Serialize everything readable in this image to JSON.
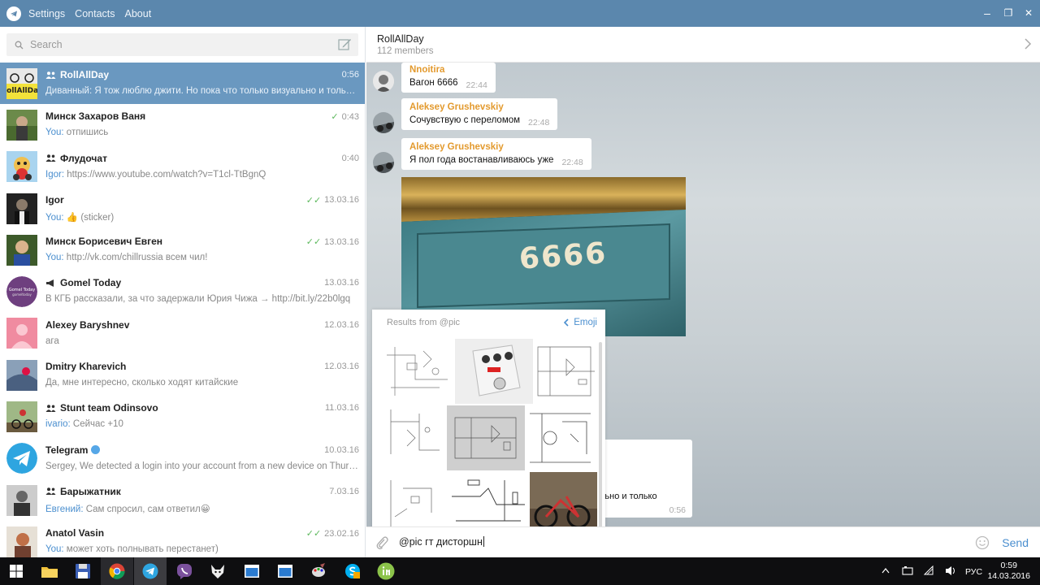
{
  "titlebar": {
    "menu": [
      "Settings",
      "Contacts",
      "About"
    ],
    "controls": {
      "minimize": "–",
      "maximize": "❐",
      "close": "✕"
    }
  },
  "search": {
    "placeholder": "Search"
  },
  "chats": [
    {
      "title": "RollAllDay",
      "group": true,
      "time": "0:56",
      "check": "",
      "sender": "",
      "preview": "Диванный: Я тож люблю джити. Но пока что только визуально и только ..."
    },
    {
      "title": "Минск Захаров Ваня",
      "group": false,
      "time": "0:43",
      "check": "✓",
      "sender": "You:",
      "preview": " отпишись"
    },
    {
      "title": "Флудочат",
      "group": true,
      "time": "0:40",
      "check": "",
      "sender": "Igor:",
      "preview": " https://www.youtube.com/watch?v=T1cl-TtBgnQ"
    },
    {
      "title": "Igor",
      "group": false,
      "time": "13.03.16",
      "check": "✓✓",
      "sender": "You:",
      "preview": " 👍 (sticker)"
    },
    {
      "title": "Минск Борисевич Евген",
      "group": false,
      "time": "13.03.16",
      "check": "✓✓",
      "sender": "You:",
      "preview": " http://vk.com/chillrussia всем чил!"
    },
    {
      "title": "Gomel Today",
      "group": false,
      "channel": true,
      "time": "13.03.16",
      "check": "",
      "sender": "",
      "preview": "В КГБ рассказали, за что задержали Юрия Чижа → http://bit.ly/22b0lgq"
    },
    {
      "title": "Alexey Baryshnev",
      "group": false,
      "time": "12.03.16",
      "check": "",
      "sender": "",
      "preview": "ага"
    },
    {
      "title": "Dmitry Kharevich",
      "group": false,
      "time": "12.03.16",
      "check": "",
      "sender": "",
      "preview": "Да, мне интересно, сколько ходят китайские"
    },
    {
      "title": "Stunt team Odinsovo",
      "group": true,
      "time": "11.03.16",
      "check": "",
      "sender": "ivario:",
      "preview": " Сейчас +10"
    },
    {
      "title": "Telegram",
      "group": false,
      "verified": true,
      "time": "10.03.16",
      "check": "",
      "sender": "",
      "preview": "Sergey, We detected a login into your account from a new device on Thurs..."
    },
    {
      "title": "Барыжатник",
      "group": true,
      "time": "7.03.16",
      "check": "",
      "sender": "Евгений:",
      "preview": " Сам спросил, сам ответил😀"
    },
    {
      "title": "Anatol Vasin",
      "group": false,
      "time": "23.02.16",
      "check": "✓✓",
      "sender": "You:",
      "preview": " может хоть полнывать перестанет)"
    }
  ],
  "chat_header": {
    "name": "RollAllDay",
    "members": "112 members"
  },
  "messages": [
    {
      "author": "Nnoitira",
      "text": "Вагон 6666",
      "time": "22:44"
    },
    {
      "author": "Aleksey Grushevskiy",
      "text": "Сочувствую с переломом",
      "time": "22:48"
    },
    {
      "author": "Aleksey Grushevskiy",
      "text": "Я пол года востанавливаюсь уже",
      "time": "22:48"
    }
  ],
  "photo_caption": "6666",
  "hidden_message": {
    "text": "льно и только",
    "time": "0:56"
  },
  "results": {
    "header": "Results from @pic",
    "back": "Emoji"
  },
  "input": {
    "value": "@pic гт дисторшн",
    "send": "Send"
  },
  "taskbar": {
    "lang": "РУС",
    "time": "0:59",
    "date": "14.03.2016"
  },
  "colors": {
    "accent": "#5b87ad",
    "active": "#6a98c0",
    "link": "#4b8fcf",
    "author": "#e39a2e"
  }
}
